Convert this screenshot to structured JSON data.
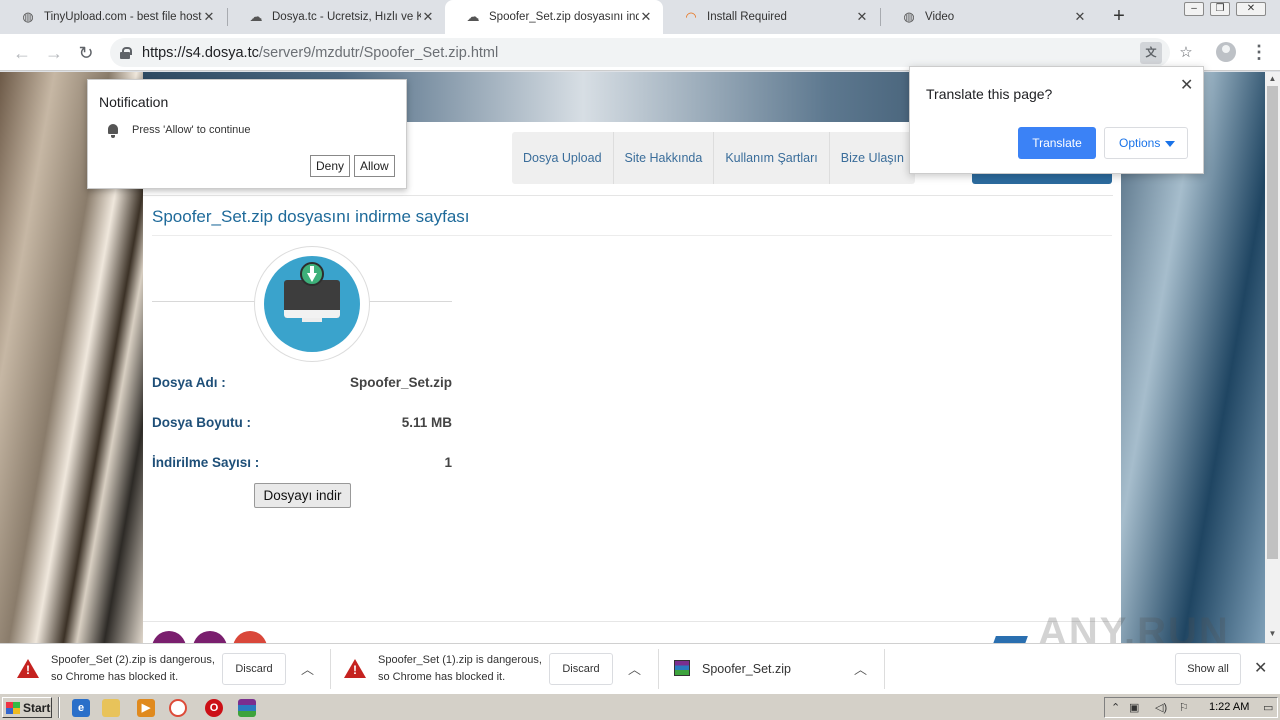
{
  "tabs": [
    {
      "title": "TinyUpload.com - best file hostin",
      "icon": "globe-icon"
    },
    {
      "title": "Dosya.tc - Ücretsiz, Hızlı ve Kola",
      "icon": "dosya-logo-icon"
    },
    {
      "title": "Spoofer_Set.zip dosyasını indir",
      "icon": "dosya-logo-icon",
      "active": true
    },
    {
      "title": "Install Required",
      "icon": "rainbow-icon"
    },
    {
      "title": "Video",
      "icon": "globe-icon"
    }
  ],
  "address_bar": {
    "host": "https://s4.dosya.tc",
    "path": "/server9/mzdutr/Spoofer_Set.zip.html"
  },
  "notification": {
    "title": "Notification",
    "message": "Press 'Allow' to continue",
    "deny_label": "Deny",
    "allow_label": "Allow"
  },
  "translate_bubble": {
    "title": "Translate this page?",
    "translate_label": "Translate",
    "options_label": "Options"
  },
  "site_nav": [
    "Dosya Upload",
    "Site Hakkında",
    "Kullanım Şartları",
    "Bize Ulaşın"
  ],
  "page": {
    "title": "Spoofer_Set.zip dosyasını indirme sayfası",
    "file_name_label": "Dosya Adı :",
    "file_name": "Spoofer_Set.zip",
    "file_size_label": "Dosya Boyutu :",
    "file_size": "5.11 MB",
    "download_count_label": "İndirilme Sayısı :",
    "download_count": "1",
    "download_button": "Dosyayı indir"
  },
  "downloads": [
    {
      "line1": "Spoofer_Set (2).zip is dangerous,",
      "line2": "so Chrome has blocked it.",
      "action": "Discard"
    },
    {
      "line1": "Spoofer_Set (1).zip is dangerous,",
      "line2": "so Chrome has blocked it.",
      "action": "Discard"
    },
    {
      "name": "Spoofer_Set.zip"
    }
  ],
  "show_all_label": "Show all",
  "taskbar": {
    "start_label": "Start",
    "clock": "1:22 AM"
  },
  "watermark": "ANY.RUN",
  "colors": {
    "accent_blue": "#3b82f6",
    "title_blue": "#1e6a9a",
    "danger_red": "#c5221f"
  }
}
